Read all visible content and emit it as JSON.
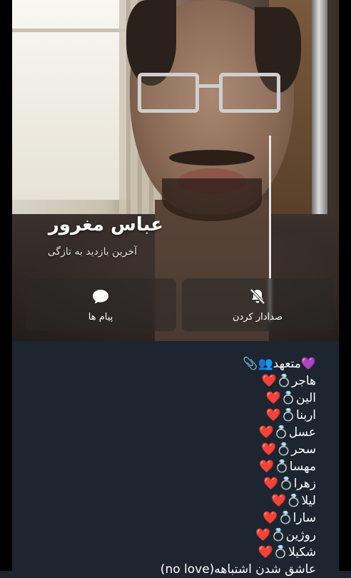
{
  "profile": {
    "name": "عباس مغرور",
    "status": "آخرین بازدید به تازگی"
  },
  "actions": {
    "message_label": "پیام ها",
    "message_icon": "chat-bubble-icon",
    "unmute_label": "صدادار کردن",
    "unmute_icon": "bell-off-icon"
  },
  "bio": {
    "lines": [
      "💜متعهد👥📎",
      "هاجر💍❤️",
      "الین💍❤️",
      "اربنا💍❤️",
      "عسل💍❤️",
      "سحر💍❤️",
      "مهسا💍❤️",
      "زهرا💍❤️",
      "لیلا💍❤️",
      "سارا💍❤️",
      "روژین💍❤️",
      "شکیلا💍❤️",
      "عاشق شدن اشتباهه(no love)"
    ]
  },
  "colors": {
    "bio_background": "#1c2530",
    "side_bars": "#000000"
  }
}
